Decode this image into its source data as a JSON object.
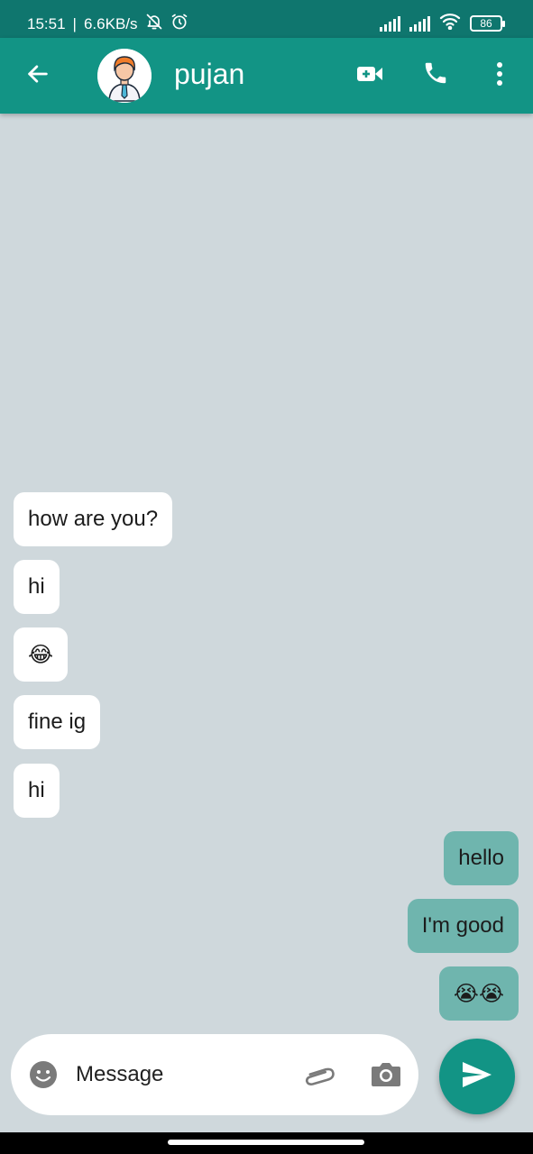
{
  "status_bar": {
    "time": "15:51",
    "separator": "|",
    "network_speed": "6.6KB/s",
    "battery": "86",
    "icons": [
      "mute-icon",
      "alarm-icon",
      "signal-icon",
      "signal-icon",
      "wifi-icon",
      "battery-icon"
    ]
  },
  "header": {
    "back_icon": "arrow-left-icon",
    "contact_name": "pujan",
    "avatar": "person-avatar",
    "actions": [
      "video-call-icon",
      "phone-icon",
      "more-vert-icon"
    ],
    "color": "#129485"
  },
  "messages": [
    {
      "direction": "incoming",
      "text": "how are you?"
    },
    {
      "direction": "incoming",
      "text": "hi"
    },
    {
      "direction": "incoming",
      "text": "😂"
    },
    {
      "direction": "incoming",
      "text": "fine ig"
    },
    {
      "direction": "incoming",
      "text": "hi"
    },
    {
      "direction": "outgoing",
      "text": "hello"
    },
    {
      "direction": "outgoing",
      "text": "I'm good"
    },
    {
      "direction": "outgoing",
      "text": "😭😭"
    }
  ],
  "composer": {
    "placeholder": "Message",
    "icons": [
      "emoji-icon",
      "paperclip-icon",
      "camera-icon",
      "send-icon"
    ]
  },
  "colors": {
    "accent": "#129485",
    "status_bar": "#0f766e",
    "chat_background": "#cfd8dc",
    "incoming_bubble": "#ffffff",
    "outgoing_bubble": "#6fb5ae"
  }
}
